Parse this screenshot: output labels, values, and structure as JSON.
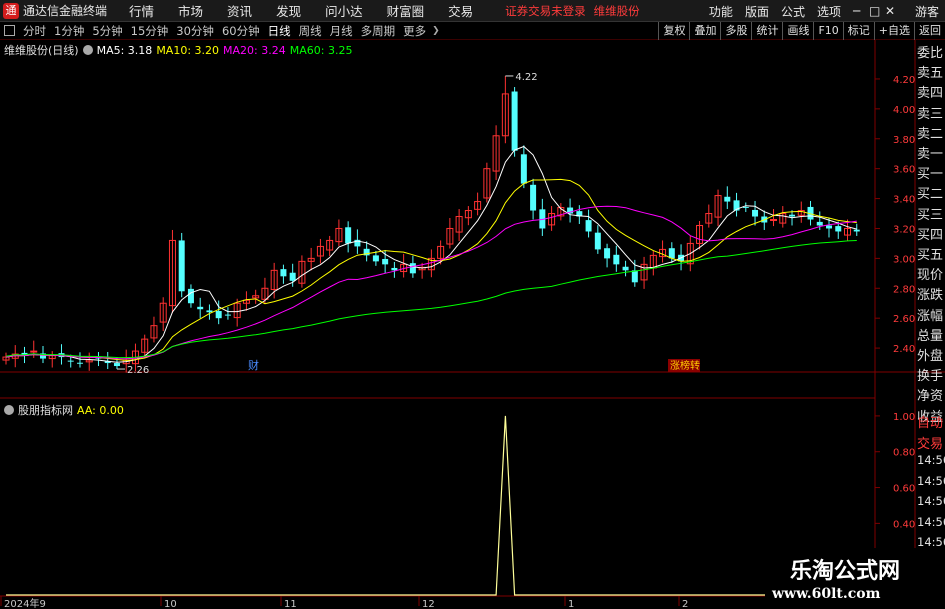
{
  "app": {
    "name": "通达信金融终端",
    "menu": [
      "行情",
      "市场",
      "资讯",
      "发现",
      "问小达",
      "财富圈",
      "交易"
    ],
    "notice": "证券交易未登录",
    "stock_tag": "维维股份",
    "right_menu": [
      "功能",
      "版面",
      "公式",
      "选项"
    ],
    "guest": "游客"
  },
  "periods": {
    "items": [
      "分时",
      "1分钟",
      "5分钟",
      "15分钟",
      "30分钟",
      "60分钟",
      "日线",
      "周线",
      "月线",
      "多周期",
      "更多"
    ],
    "active": "日线"
  },
  "toolbar": [
    "复权",
    "叠加",
    "多股",
    "统计",
    "画线",
    "F10",
    "标记",
    "+自选",
    "返回"
  ],
  "main_legend": {
    "title": "维维股份(日线)",
    "ma5": "MA5: 3.18",
    "ma10": "MA10: 3.20",
    "ma20": "MA20: 3.24",
    "ma60": "MA60: 3.25"
  },
  "sub_legend": {
    "title": "股朋指标网",
    "aa": "AA: 0.00"
  },
  "price_axis": [
    "4.20",
    "4.00",
    "3.80",
    "3.60",
    "3.40",
    "3.20",
    "3.00",
    "2.80",
    "2.60",
    "2.40"
  ],
  "sub_axis": [
    "1.00",
    "0.80",
    "0.60",
    "0.40"
  ],
  "annotations": {
    "high": "4.22",
    "low": "2.26",
    "cai": "财",
    "zhang": "涨榜转"
  },
  "date_axis": [
    "2024年9",
    "10",
    "11",
    "12",
    "1",
    "2"
  ],
  "right_panel": [
    "委比",
    "卖五",
    "卖四",
    "卖三",
    "卖二",
    "卖一",
    "买一",
    "买二",
    "买三",
    "买四",
    "买五",
    "现价",
    "涨跌",
    "涨幅",
    "总量",
    "外盘",
    "换手",
    "净资",
    "收益"
  ],
  "right_panel2": [
    "自动",
    "交易",
    "14:56",
    "14:56",
    "14:56",
    "14:56",
    "14:56",
    "14:56",
    "14:56",
    "14:56"
  ],
  "watermark": {
    "cn": "乐淘公式网",
    "url": "www.60lt.com"
  },
  "colors": {
    "up": "#ff3232",
    "down": "#54ffff",
    "ma5": "#ffffff",
    "ma10": "#ffff00",
    "ma20": "#ff00ff",
    "ma60": "#00ff00",
    "grid": "#800000"
  },
  "chart_data": {
    "type": "candlestick",
    "title": "维维股份(日线)",
    "series": [
      {
        "name": "MA5",
        "last": 3.18
      },
      {
        "name": "MA10",
        "last": 3.2
      },
      {
        "name": "MA20",
        "last": 3.24
      },
      {
        "name": "MA60",
        "last": 3.25
      }
    ],
    "ylim": [
      2.2,
      4.3
    ],
    "high": 4.22,
    "low": 2.26,
    "close": [
      2.34,
      2.36,
      2.35,
      2.38,
      2.33,
      2.35,
      2.34,
      2.31,
      2.3,
      2.32,
      2.33,
      2.3,
      2.28,
      2.32,
      2.38,
      2.46,
      2.55,
      2.7,
      3.12,
      2.78,
      2.7,
      2.66,
      2.64,
      2.6,
      2.62,
      2.7,
      2.72,
      2.75,
      2.8,
      2.92,
      2.88,
      2.85,
      2.98,
      3.0,
      3.08,
      3.12,
      3.2,
      3.1,
      3.08,
      3.02,
      2.98,
      2.96,
      2.92,
      2.96,
      2.9,
      2.94,
      3.0,
      3.08,
      3.2,
      3.28,
      3.32,
      3.38,
      3.6,
      3.82,
      4.1,
      3.72,
      3.5,
      3.32,
      3.2,
      3.3,
      3.34,
      3.3,
      3.28,
      3.18,
      3.06,
      3.0,
      2.96,
      2.92,
      2.84,
      2.96,
      3.02,
      3.06,
      3.0,
      2.98,
      3.1,
      3.22,
      3.3,
      3.42,
      3.38,
      3.32,
      3.34,
      3.28,
      3.24,
      3.26,
      3.3,
      3.28,
      3.32,
      3.26,
      3.22,
      3.2,
      3.18,
      3.2,
      3.18
    ],
    "sub_series": {
      "name": "AA",
      "spike_index": 54,
      "spike_value": 1.0,
      "base": 0.0,
      "ylim": [
        0,
        1.1
      ]
    }
  }
}
